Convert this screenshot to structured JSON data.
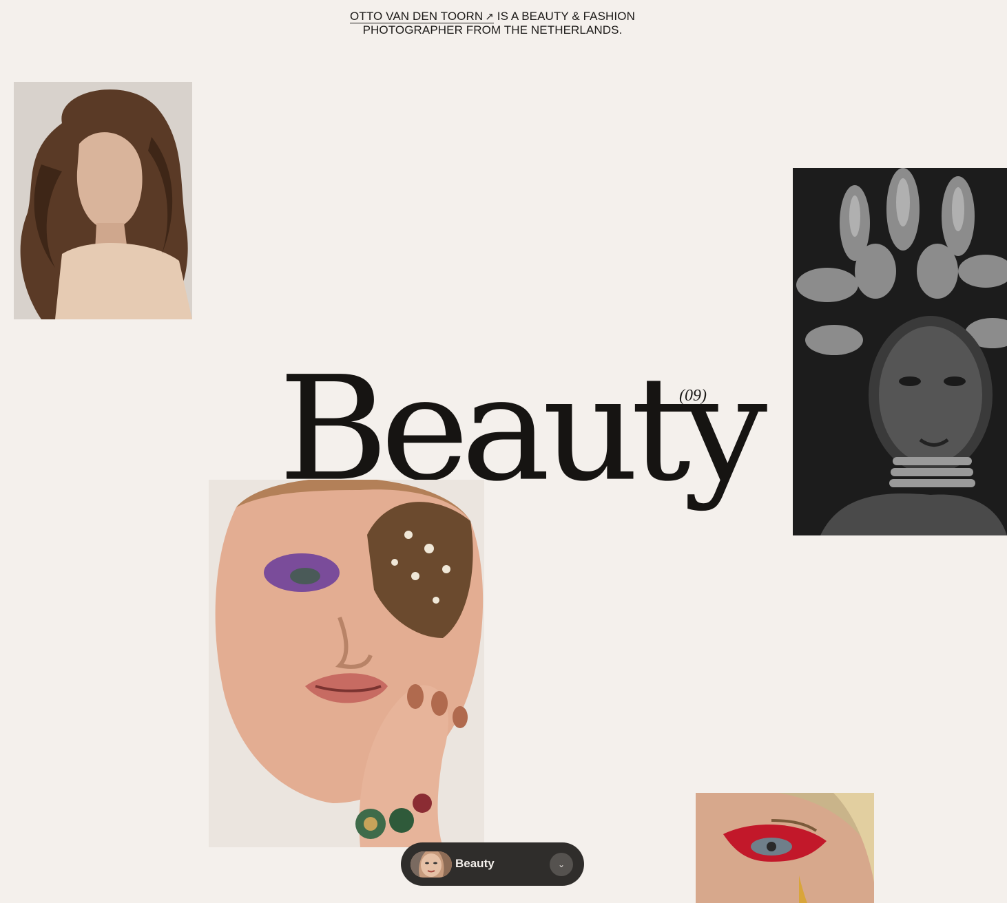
{
  "header": {
    "photographer_link": "OTTO VAN DEN TOORN",
    "link_icon": "arrow-up-right-icon",
    "link_arrow_glyph": "↗",
    "tagline_line1_rest": "IS A BEAUTY & FASHION",
    "tagline_line2": "PHOTOGRAPHER FROM THE NETHERLANDS."
  },
  "category": {
    "title": "Beauty",
    "count": "(09)"
  },
  "gallery": {
    "photos": [
      {
        "subject": "model-voluminous-brown-hair"
      },
      {
        "subject": "model-silver-sculpted-hair"
      },
      {
        "subject": "model-butterfly-eye"
      },
      {
        "subject": "model-red-eyeshadow"
      }
    ]
  },
  "category_switcher": {
    "label": "Beauty",
    "toggle_icon": "chevron-down-icon",
    "toggle_glyph": "⌄"
  },
  "colors": {
    "background": "#f4f0ec",
    "text": "#1c1a18",
    "pill": "#2f2d2b",
    "pill_toggle": "#55524f"
  }
}
